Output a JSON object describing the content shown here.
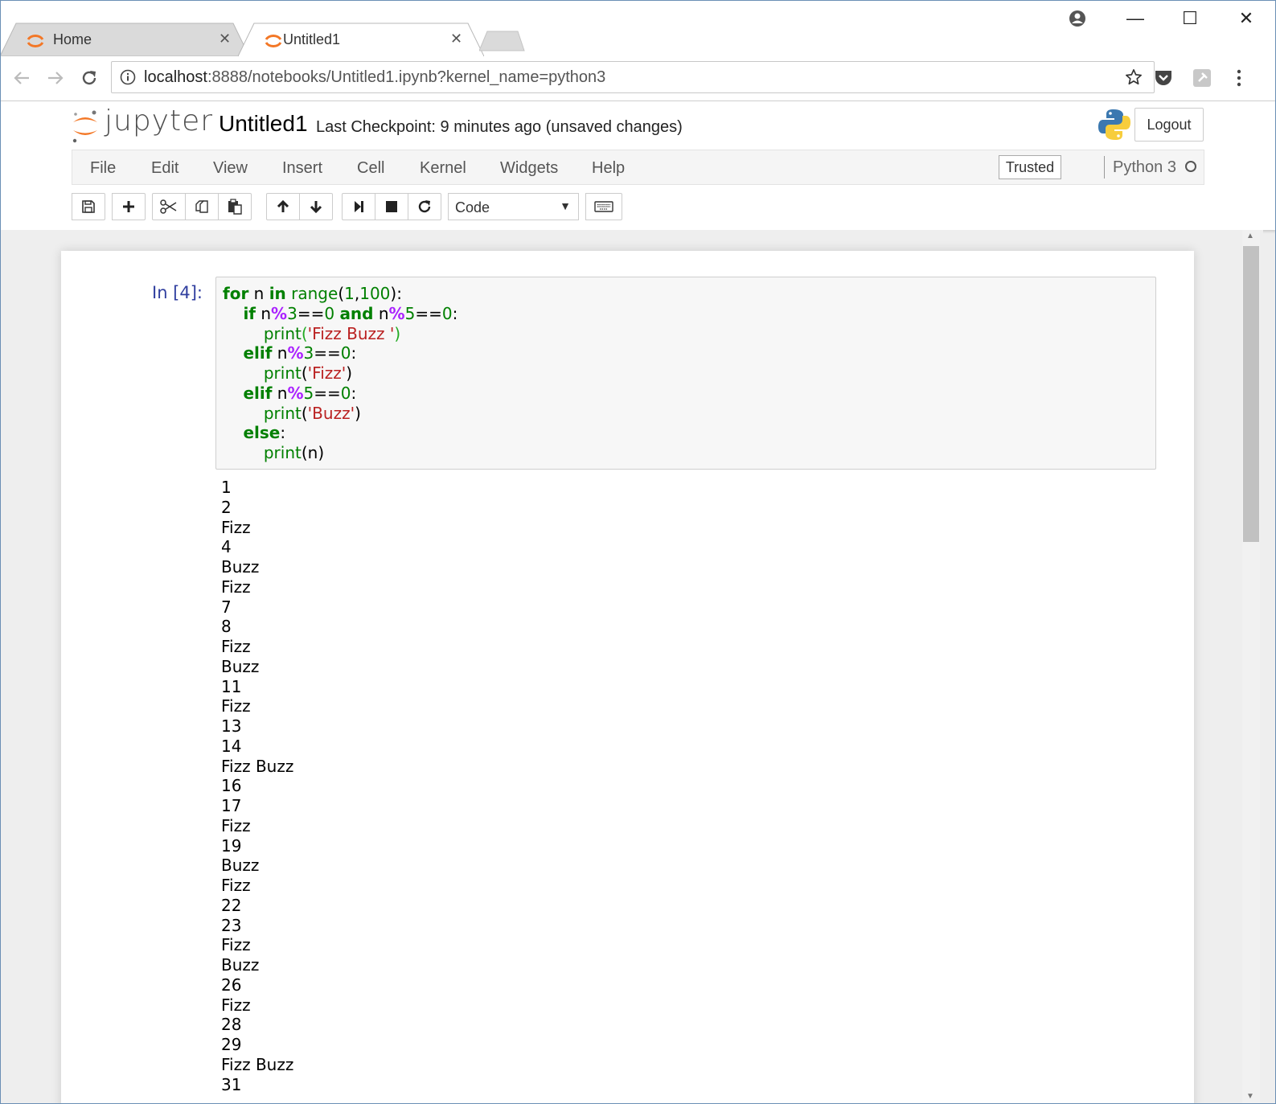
{
  "browser": {
    "tabs": [
      {
        "title": "Home",
        "active": false
      },
      {
        "title": "Untitled1",
        "active": true
      }
    ],
    "tab_close_glyph": "✕",
    "url_host": "localhost",
    "url_rest": ":8888/notebooks/Untitled1.ipynb?kernel_name=python3",
    "window_controls": {
      "minimize": "—",
      "maximize": "☐",
      "close": "✕"
    }
  },
  "header": {
    "logo_text": "jupyter",
    "notebook_name": "Untitled1",
    "checkpoint": "Last Checkpoint: 9 minutes ago (unsaved changes)",
    "logout_label": "Logout"
  },
  "menubar": {
    "items": [
      "File",
      "Edit",
      "View",
      "Insert",
      "Cell",
      "Kernel",
      "Widgets",
      "Help"
    ],
    "trusted_label": "Trusted",
    "kernel_label": "Python 3"
  },
  "toolbar": {
    "cell_type": "Code",
    "cell_type_arrow": "▼"
  },
  "cell": {
    "prompt": "In [4]:",
    "code_lines": [
      "for n in range(1,100):",
      "    if n%3==0 and n%5==0:",
      "        print('Fizz Buzz ')",
      "    elif n%3==0:",
      "        print('Fizz')",
      "    elif n%5==0:",
      "        print('Buzz')",
      "    else:",
      "        print(n)"
    ],
    "output_lines": [
      "1",
      "2",
      "Fizz",
      "4",
      "Buzz",
      "Fizz",
      "7",
      "8",
      "Fizz",
      "Buzz",
      "11",
      "Fizz",
      "13",
      "14",
      "Fizz Buzz",
      "16",
      "17",
      "Fizz",
      "19",
      "Buzz",
      "Fizz",
      "22",
      "23",
      "Fizz",
      "Buzz",
      "26",
      "Fizz",
      "28",
      "29",
      "Fizz Buzz",
      "31"
    ]
  },
  "icons": {
    "tab_icon": "jupyter-spinner-icon",
    "back": "arrow-left-icon",
    "forward": "arrow-right-icon",
    "reload": "reload-icon",
    "info": "info-icon",
    "star": "star-icon",
    "pocket": "pocket-icon",
    "extension": "pin-extension-icon",
    "menu": "kebab-menu-icon",
    "account": "account-icon"
  },
  "colors": {
    "jupyter_orange": "#f37726",
    "prompt_blue": "#303f9f",
    "keyword_green": "#008000",
    "operator_purple": "#aa22ff",
    "string_red": "#ba2121"
  }
}
